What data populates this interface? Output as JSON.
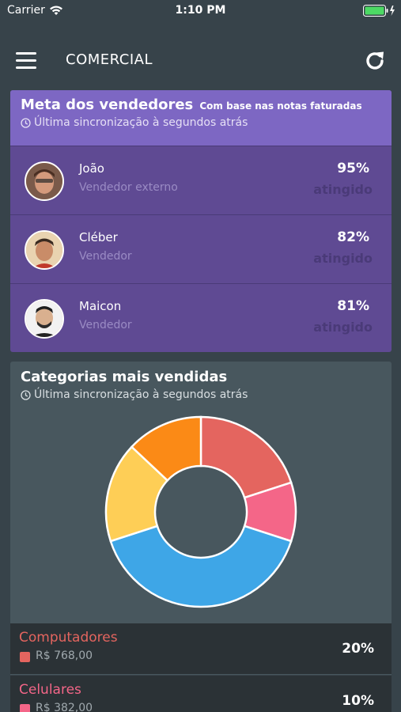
{
  "status_bar": {
    "carrier": "Carrier",
    "time": "1:10 PM"
  },
  "nav": {
    "title": "COMERCIAL",
    "menu_icon": "hamburger-menu-icon",
    "refresh_icon": "refresh-icon"
  },
  "sales_card": {
    "title": "Meta dos vendedores",
    "subtitle": "Com base nas notas faturadas",
    "sync_text": "Última sincronização à segundos atrás",
    "sellers": [
      {
        "name": "João",
        "role": "Vendedor externo",
        "percent": "95%",
        "status": "atingido"
      },
      {
        "name": "Cléber",
        "role": "Vendedor",
        "percent": "82%",
        "status": "atingido"
      },
      {
        "name": "Maicon",
        "role": "Vendedor",
        "percent": "81%",
        "status": "atingido"
      }
    ]
  },
  "categories_card": {
    "title": "Categorias mais vendidas",
    "sync_text": "Última sincronização à segundos atrás",
    "items": [
      {
        "name": "Computadores",
        "value": "R$ 768,00",
        "percent": "20%",
        "color": "#e4655f"
      },
      {
        "name": "Celulares",
        "value": "R$ 382,00",
        "percent": "10%",
        "color": "#f46688"
      }
    ]
  },
  "chart_data": {
    "type": "pie",
    "slices": [
      {
        "value": 20,
        "color": "#e4655f"
      },
      {
        "value": 10,
        "color": "#f46688"
      },
      {
        "value": 40,
        "color": "#3ea6e7"
      },
      {
        "value": 17,
        "color": "#fece56"
      },
      {
        "value": 13,
        "color": "#fb8a16"
      }
    ]
  }
}
